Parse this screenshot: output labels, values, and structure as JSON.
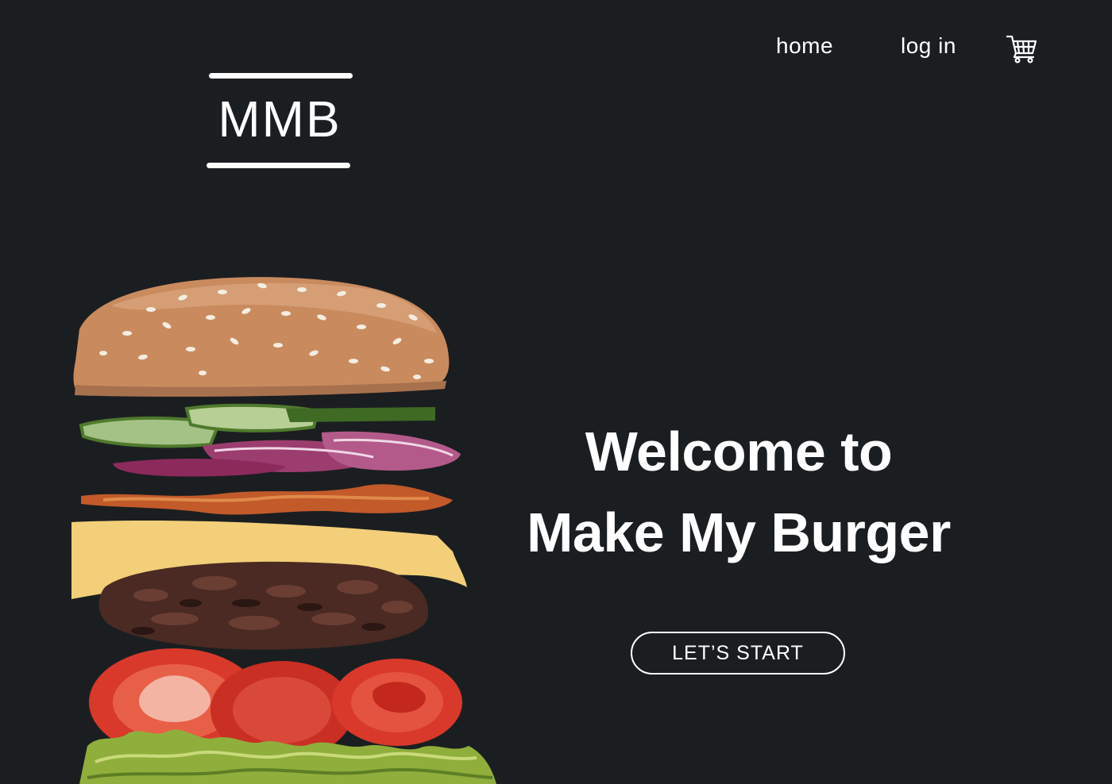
{
  "nav": {
    "home": "home",
    "login": "log in",
    "cart_icon": "shopping-cart-icon"
  },
  "logo": {
    "text": "MMB"
  },
  "hero": {
    "line1": "Welcome to",
    "line2": "Make My Burger",
    "cta": "LET’S START",
    "image": "exploded-burger-illustration"
  },
  "colors": {
    "background": "#1b1e21",
    "text": "#ffffff",
    "bun": "#c98b5e",
    "cheese": "#f2cf78",
    "tomato": "#d8392b",
    "lettuce": "#8fae3c",
    "onion": "#8c2a5c",
    "cucumber": "#4f7a2c",
    "patty": "#4a2a22"
  }
}
